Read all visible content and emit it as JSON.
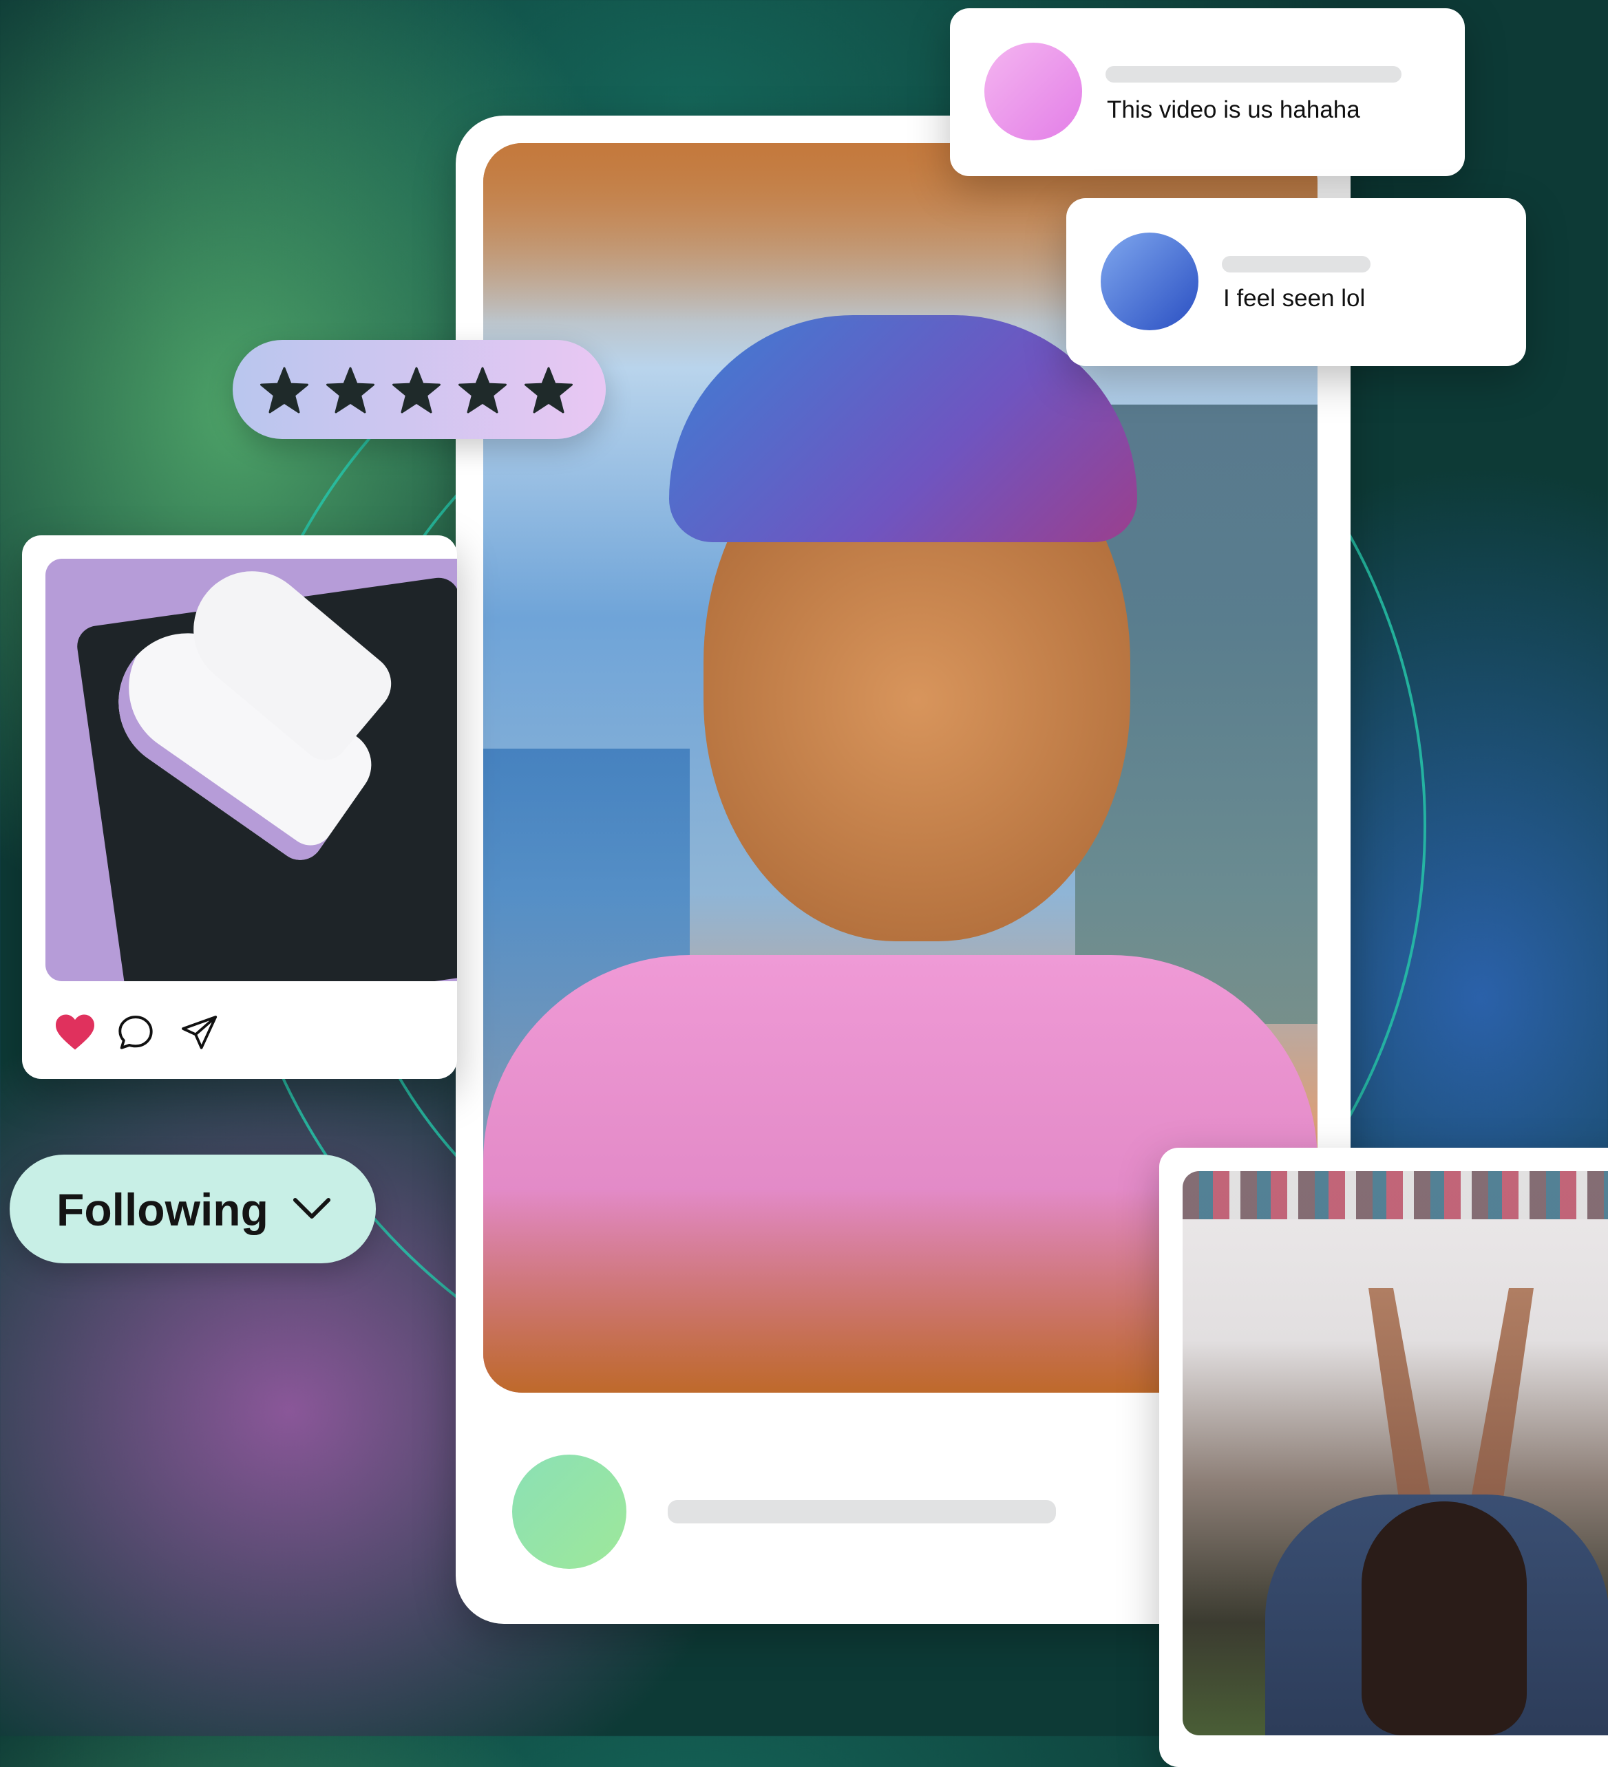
{
  "comments": [
    {
      "text": "This video is us hahaha",
      "avatar": "pink-avatar"
    },
    {
      "text": "I feel seen lol",
      "avatar": "blue-avatar"
    }
  ],
  "rating": {
    "stars": 5,
    "max": 5,
    "icon": "star-icon"
  },
  "post_actions": [
    "heart-icon",
    "comment-icon",
    "send-icon"
  ],
  "filter": {
    "label": "Following",
    "icon": "chevron-down-icon"
  },
  "colors": {
    "accent_teal": "#26c4a8",
    "like_red": "#e0315d",
    "pill_bg": "#c8efe6",
    "star_dark": "#1f2a2a"
  }
}
